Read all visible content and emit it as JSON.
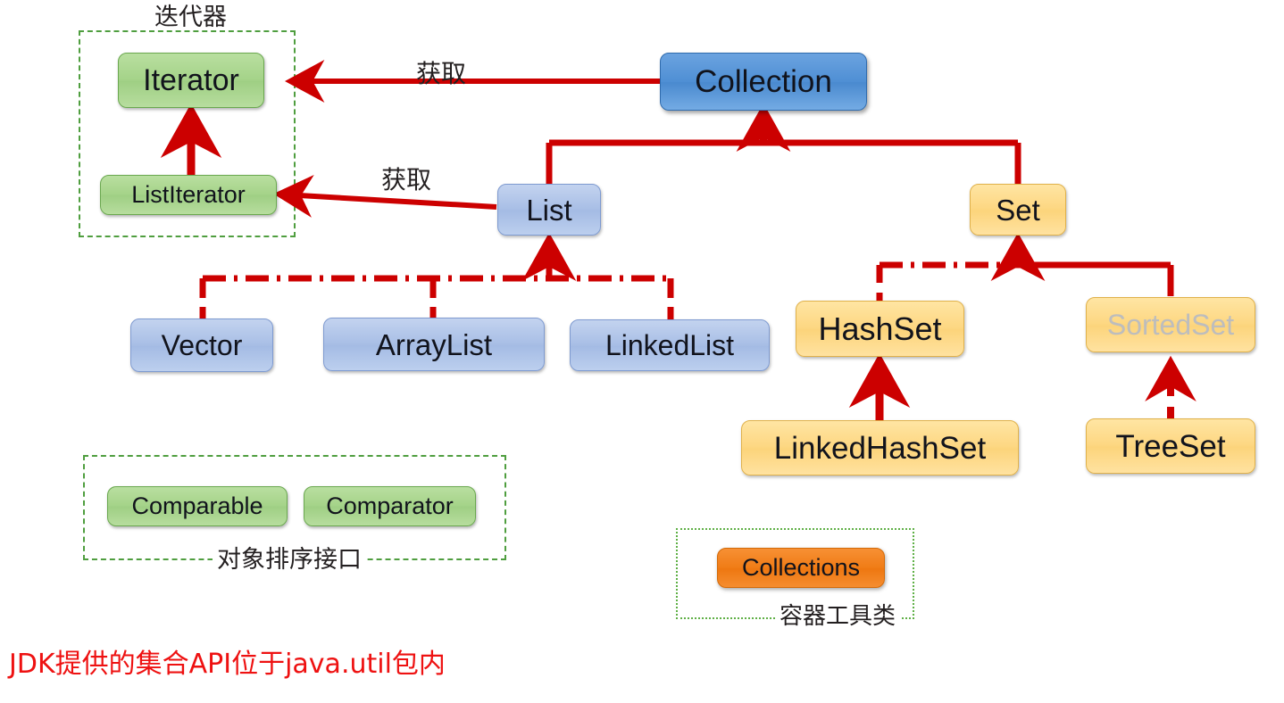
{
  "diagram": {
    "title_note": "JDK提供的集合API位于java.util包内",
    "accent_red": "#cc0000",
    "group_green": "#4f9e3f",
    "colors": {
      "interface_green": "#a5d389",
      "collection_blue": "#4f8fd4",
      "list_blue": "#a9bfe6",
      "set_amber": "#fdd782",
      "collections_orange": "#f07c16",
      "faded_gray": "#bdbdbd",
      "edge_red": "#cc0000",
      "footnote_red": "#ee1111"
    }
  },
  "groups": [
    {
      "id": "iterator-group",
      "label": "迭代器",
      "label_pos": "top"
    },
    {
      "id": "comparator-group",
      "label": "对象排序接口",
      "label_pos": "bottom"
    },
    {
      "id": "collections-group",
      "label": "容器工具类",
      "label_pos": "bottom"
    }
  ],
  "nodes": {
    "iterator": {
      "label": "Iterator",
      "kind": "interface"
    },
    "list_iterator": {
      "label": "ListIterator",
      "kind": "interface"
    },
    "collection": {
      "label": "Collection",
      "kind": "root-interface"
    },
    "list": {
      "label": "List",
      "kind": "interface"
    },
    "set": {
      "label": "Set",
      "kind": "interface"
    },
    "vector": {
      "label": "Vector",
      "kind": "class"
    },
    "arraylist": {
      "label": "ArrayList",
      "kind": "class"
    },
    "linkedlist": {
      "label": "LinkedList",
      "kind": "class"
    },
    "hashset": {
      "label": "HashSet",
      "kind": "class"
    },
    "sortedset": {
      "label": "SortedSet",
      "kind": "interface-faded"
    },
    "linkedhashset": {
      "label": "LinkedHashSet",
      "kind": "class"
    },
    "treeset": {
      "label": "TreeSet",
      "kind": "class"
    },
    "comparable": {
      "label": "Comparable",
      "kind": "interface"
    },
    "comparator": {
      "label": "Comparator",
      "kind": "interface"
    },
    "collections": {
      "label": "Collections",
      "kind": "utility"
    }
  },
  "edge_labels": {
    "collection_to_iterator": "获取",
    "list_to_listiterator": "获取"
  }
}
